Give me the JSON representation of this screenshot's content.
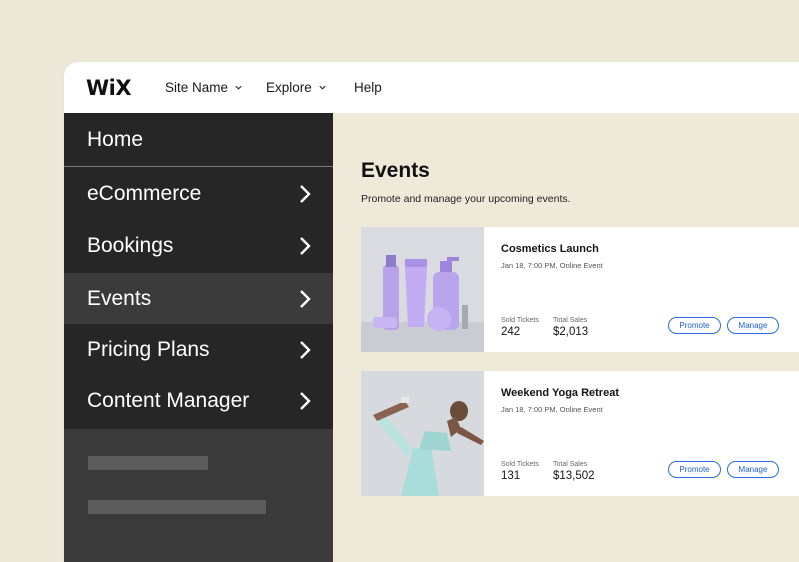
{
  "header": {
    "logo": "WiX",
    "nav": [
      {
        "label": "Site Name",
        "has_dropdown": true
      },
      {
        "label": "Explore",
        "has_dropdown": true
      },
      {
        "label": "Help",
        "has_dropdown": false
      }
    ]
  },
  "sidebar": {
    "items": [
      {
        "label": "Home",
        "has_arrow": false
      },
      {
        "label": "eCommerce",
        "has_arrow": true
      },
      {
        "label": "Bookings",
        "has_arrow": true
      },
      {
        "label": "Events",
        "has_arrow": true,
        "selected": true
      },
      {
        "label": "Pricing Plans",
        "has_arrow": true
      },
      {
        "label": "Content Manager",
        "has_arrow": true
      }
    ]
  },
  "main": {
    "title": "Events",
    "subtitle": "Promote and manage your upcoming events.",
    "events": [
      {
        "title": "Cosmetics Launch",
        "date": "Jan 18, 7:00 PM, Online Event",
        "sold_label": "Sold Tickets",
        "sold": "242",
        "sales_label": "Total Sales",
        "sales": "$2,013",
        "promote": "Promote",
        "manage": "Manage"
      },
      {
        "title": "Weekend Yoga Retreat",
        "date": "Jan 18, 7:00 PM, Online Event",
        "sold_label": "Sold Tickets",
        "sold": "131",
        "sales_label": "Total Sales",
        "sales": "$13,502",
        "promote": "Promote",
        "manage": "Manage"
      }
    ]
  },
  "colors": {
    "background": "#ede7d7",
    "sidebar": "#262626",
    "sidebar_selected": "#3b3b3b",
    "accent": "#2d6fe0"
  }
}
